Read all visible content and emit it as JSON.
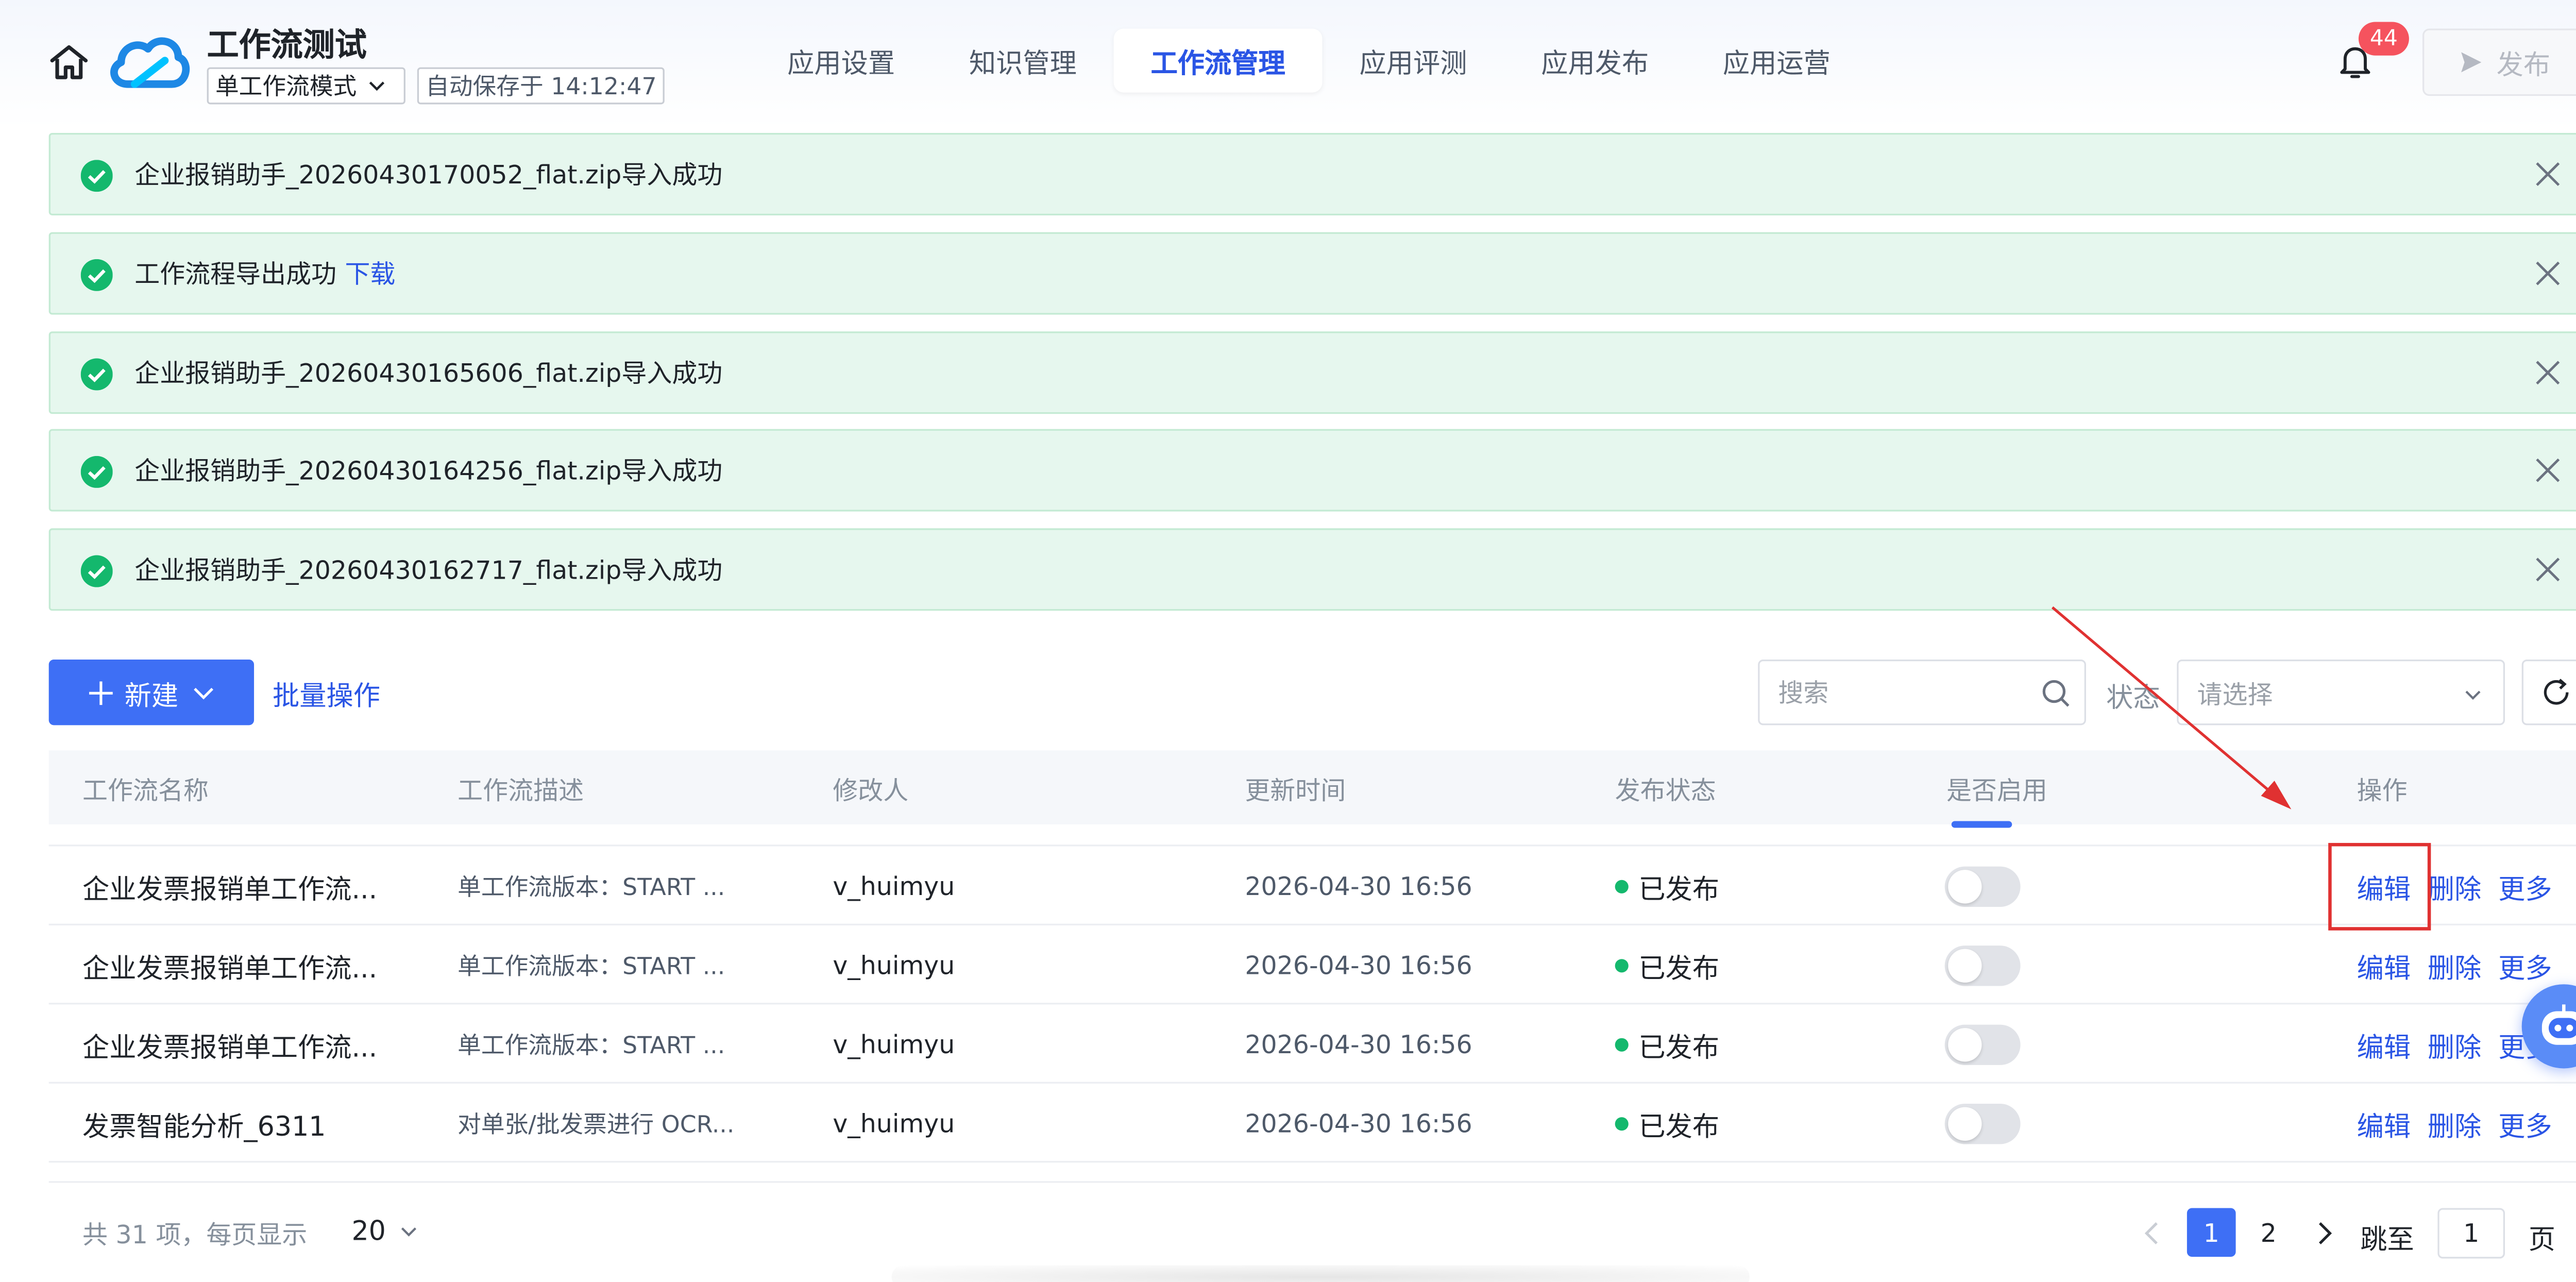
{
  "header": {
    "app_title": "工作流测试",
    "mode_select": "单工作流模式",
    "autosave": "自动保存于 14:12:47",
    "tabs": [
      {
        "label": "应用设置",
        "active": false
      },
      {
        "label": "知识管理",
        "active": false
      },
      {
        "label": "工作流管理",
        "active": true
      },
      {
        "label": "应用评测",
        "active": false
      },
      {
        "label": "应用发布",
        "active": false
      },
      {
        "label": "应用运营",
        "active": false
      }
    ],
    "notification_count": "44",
    "publish_label": "发布",
    "icons": {
      "home": "home-icon",
      "logo": "cloud-logo",
      "bell": "bell-icon",
      "publish": "send-icon"
    }
  },
  "notices": [
    {
      "text": "企业报销助手_20260430170052_flat.zip导入成功",
      "link": ""
    },
    {
      "text": "工作流程导出成功",
      "link": "下载"
    },
    {
      "text": "企业报销助手_20260430165606_flat.zip导入成功",
      "link": ""
    },
    {
      "text": "企业报销助手_20260430164256_flat.zip导入成功",
      "link": ""
    },
    {
      "text": "企业报销助手_20260430162717_flat.zip导入成功",
      "link": ""
    }
  ],
  "toolbar": {
    "new_label": "新建",
    "batch_label": "批量操作",
    "search_placeholder": "搜索",
    "status_label": "状态",
    "status_placeholder": "请选择"
  },
  "table": {
    "columns": [
      "工作流名称",
      "工作流描述",
      "修改人",
      "更新时间",
      "发布状态",
      "是否启用",
      "操作"
    ],
    "rows": [
      {
        "name": "企业发票报销单工作流...",
        "desc": "单工作流版本：START ...",
        "user": "v_huimyu",
        "time": "2026-04-30 16:56",
        "status": "已发布",
        "enabled": false
      },
      {
        "name": "企业发票报销单工作流...",
        "desc": "单工作流版本：START ...",
        "user": "v_huimyu",
        "time": "2026-04-30 16:56",
        "status": "已发布",
        "enabled": false
      },
      {
        "name": "企业发票报销单工作流...",
        "desc": "单工作流版本：START ...",
        "user": "v_huimyu",
        "time": "2026-04-30 16:56",
        "status": "已发布",
        "enabled": false
      },
      {
        "name": "发票智能分析_6311",
        "desc": "对单张/批发票进行 OCR...",
        "user": "v_huimyu",
        "time": "2026-04-30 16:56",
        "status": "已发布",
        "enabled": false
      }
    ],
    "ops": {
      "edit": "编辑",
      "delete": "删除",
      "more": "更多"
    }
  },
  "pagination": {
    "total_text": "共 31 项，每页显示",
    "page_size": "20",
    "pages": [
      "1",
      "2"
    ],
    "current_page": "1",
    "jump_label": "跳至",
    "jump_value": "1",
    "page_unit": "页"
  },
  "colors": {
    "accent": "#3e6ff5",
    "success": "#14b86d",
    "notice_bg": "#e6f7ee",
    "annotation": "#e03131",
    "badge": "#f5535e"
  }
}
